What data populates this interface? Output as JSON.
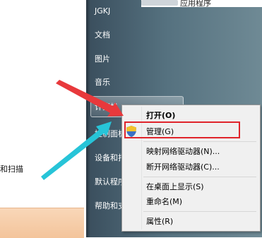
{
  "start_menu": {
    "left_text": "和扫描",
    "top_right_text": "应用程序",
    "right_items": [
      {
        "label": "JGKJ"
      },
      {
        "label": "文档"
      },
      {
        "label": "图片"
      },
      {
        "label": "音乐"
      },
      {
        "label": "计算机"
      },
      {
        "label": "控制面板"
      },
      {
        "label": "设备和打"
      },
      {
        "label": "默认程序"
      },
      {
        "label": "帮助和支"
      }
    ]
  },
  "context_menu": {
    "items": [
      {
        "label": "打开(O)",
        "bold": true
      },
      {
        "label": "管理(G)",
        "icon": "uac-shield-icon",
        "highlighted": true
      },
      {
        "label": "映射网络驱动器(N)..."
      },
      {
        "label": "断开网络驱动器(C)..."
      },
      {
        "label": "在桌面上显示(S)"
      },
      {
        "label": "重命名(M)"
      },
      {
        "label": "属性(R)"
      }
    ]
  },
  "annotations": {
    "highlight_color": "#e0242b",
    "arrow_colors": [
      "#e8393c",
      "#27c4d8"
    ]
  }
}
